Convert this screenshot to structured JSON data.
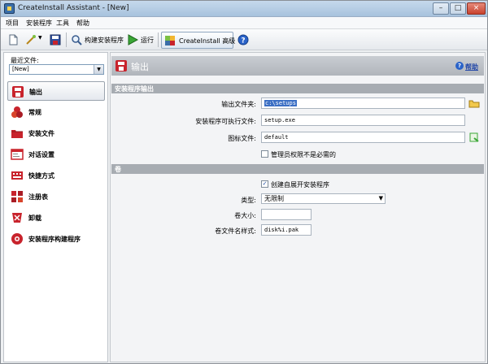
{
  "window": {
    "title": "CreateInstall Assistant - [New]",
    "min_label": "–",
    "max_label": "□",
    "close_label": "×"
  },
  "menu": {
    "items": [
      "项目",
      "安装程序",
      "工具",
      "帮助"
    ]
  },
  "toolbar": {
    "build_label": "构建安装程序",
    "run_label": "运行",
    "advanced_label": "CreateInstall 高级"
  },
  "sidebar": {
    "recent_label": "最近文件:",
    "recent_value": "[New]",
    "items": [
      {
        "label": "输出",
        "icon": "output-disk-icon",
        "active": true
      },
      {
        "label": "常规",
        "icon": "general-puzzle-icon",
        "active": false
      },
      {
        "label": "安装文件",
        "icon": "folder-icon",
        "active": false
      },
      {
        "label": "对话设置",
        "icon": "dialog-icon",
        "active": false
      },
      {
        "label": "快捷方式",
        "icon": "shortcut-icon",
        "active": false
      },
      {
        "label": "注册表",
        "icon": "registry-icon",
        "active": false
      },
      {
        "label": "卸载",
        "icon": "uninstall-icon",
        "active": false
      },
      {
        "label": "安装程序构建程序",
        "icon": "builder-icon",
        "active": false
      }
    ]
  },
  "main": {
    "title": "输出",
    "help_label": "帮助",
    "section_output": "安装程序输出",
    "output_folder_label": "输出文件夹:",
    "output_folder_value": "c:\\setups",
    "setup_exe_label": "安装程序可执行文件:",
    "setup_exe_value": "setup.exe",
    "icon_file_label": "图标文件:",
    "icon_file_value": "default",
    "admin_label": "管理员权限不是必需的",
    "admin_checked": false,
    "section_volume": "卷",
    "selfextract_label": "创建自展开安装程序",
    "selfextract_checked": true,
    "type_label": "类型:",
    "type_value": "无限制",
    "size_label": "卷大小:",
    "size_value": "",
    "pattern_label": "卷文件名样式:",
    "pattern_value": "disk%i.pak"
  },
  "colors": {
    "accent_red": "#c8232c",
    "selection_blue": "#3b6fc4",
    "help_link": "#2448a8"
  }
}
